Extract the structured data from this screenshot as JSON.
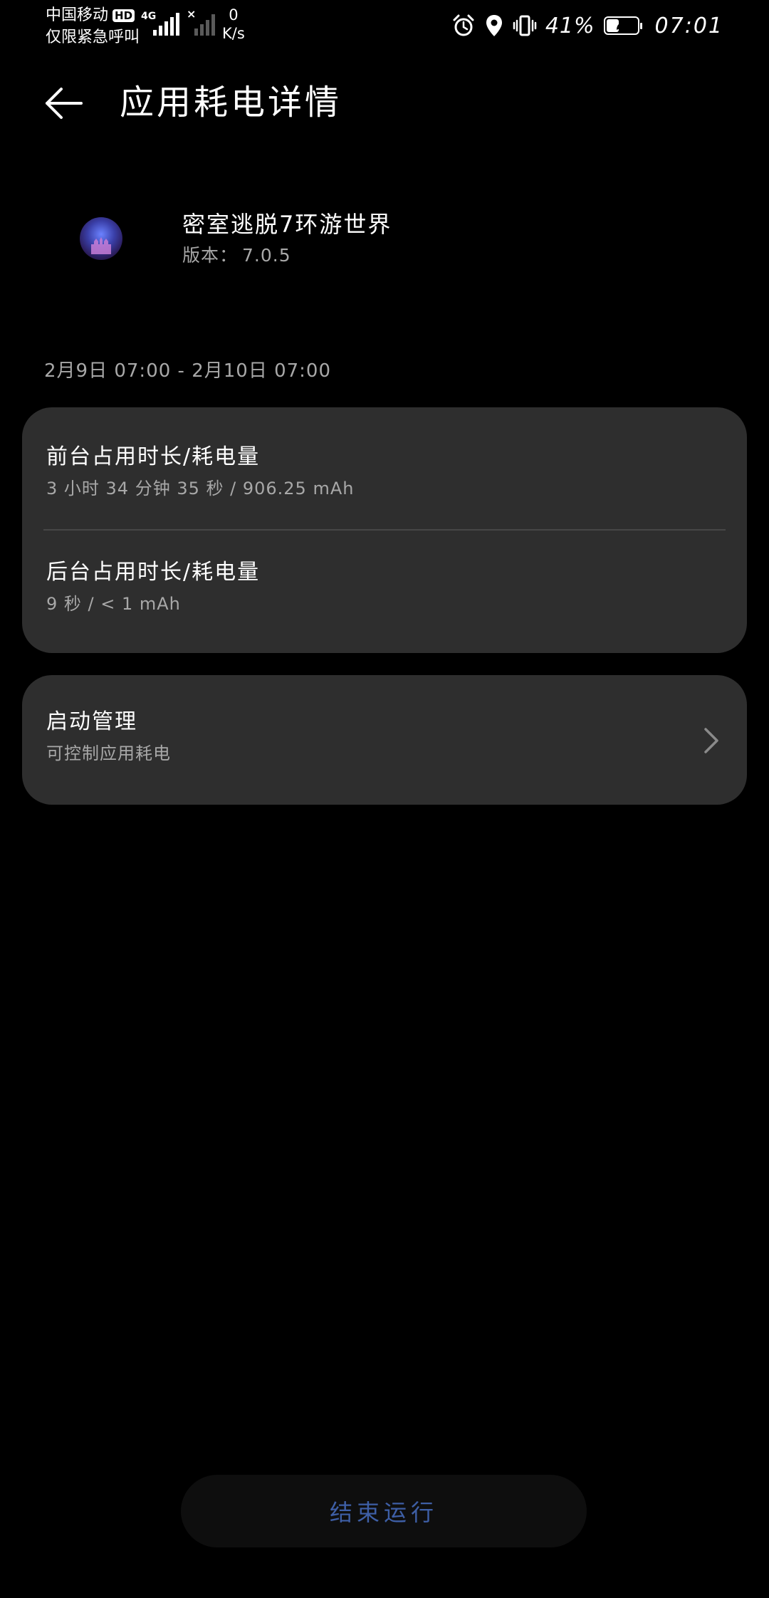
{
  "status_bar": {
    "carrier": "中国移动",
    "hd_badge": "HD",
    "emergency_text": "仅限紧急呼叫",
    "network_type": "4G",
    "speed_value": "0",
    "speed_unit": "K/s",
    "battery_percent": "41%",
    "battery_level": 0.41,
    "time": "07:01"
  },
  "header": {
    "title": "应用耗电详情"
  },
  "app": {
    "name": "密室逃脱7环游世界",
    "version_label": "版本：",
    "version_value": "7.0.5"
  },
  "date_range": "2月9日 07:00 - 2月10日 07:00",
  "usage": {
    "foreground_title": "前台占用时长/耗电量",
    "foreground_value": "3 小时 34 分钟 35 秒 / 906.25 mAh",
    "background_title": "后台占用时长/耗电量",
    "background_value": "9 秒 / < 1 mAh"
  },
  "launch": {
    "title": "启动管理",
    "subtitle": "可控制应用耗电"
  },
  "footer": {
    "stop_button": "结束运行"
  },
  "colors": {
    "background": "#000000",
    "card": "#2e2e2e",
    "secondary_text": "#a8a8a8",
    "button_text": "#3e5fa6"
  }
}
